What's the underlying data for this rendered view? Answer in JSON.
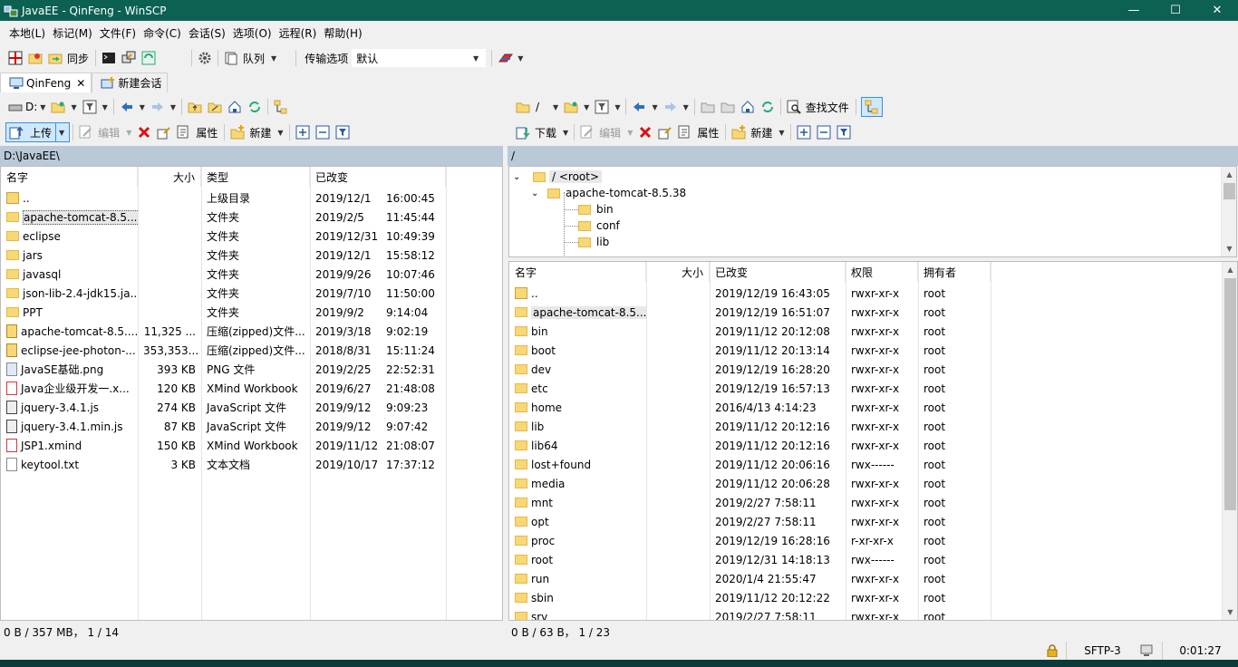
{
  "window": {
    "title": "JavaEE - QinFeng - WinSCP",
    "min": "—",
    "max": "☐",
    "close": "✕"
  },
  "menu": [
    "本地(L)",
    "标记(M)",
    "文件(F)",
    "命令(C)",
    "会话(S)",
    "选项(O)",
    "远程(R)",
    "帮助(H)"
  ],
  "toolbar": {
    "sync": "同步",
    "queue": "队列",
    "transfer_label": "传输选项",
    "transfer_value": "默认"
  },
  "tabs": [
    {
      "label": "QinFeng",
      "close": "✕"
    },
    {
      "label": "新建会话"
    }
  ],
  "left": {
    "drive": "D:",
    "upload": "上传",
    "edit": "编辑",
    "props": "属性",
    "new": "新建",
    "path": "D:\\JavaEE\\",
    "columns": [
      "名字",
      "大小",
      "类型",
      "已改变"
    ],
    "rows": [
      {
        "name": "..",
        "size": "",
        "type": "上级目录",
        "date": "2019/12/1",
        "time": "16:00:45",
        "icon": "up"
      },
      {
        "name": "apache-tomcat-8.5....",
        "size": "",
        "type": "文件夹",
        "date": "2019/2/5",
        "time": "11:45:44",
        "icon": "folder"
      },
      {
        "name": "eclipse",
        "size": "",
        "type": "文件夹",
        "date": "2019/12/31",
        "time": "10:49:39",
        "icon": "folder"
      },
      {
        "name": "jars",
        "size": "",
        "type": "文件夹",
        "date": "2019/12/1",
        "time": "15:58:12",
        "icon": "folder"
      },
      {
        "name": "javasql",
        "size": "",
        "type": "文件夹",
        "date": "2019/9/26",
        "time": "10:07:46",
        "icon": "folder"
      },
      {
        "name": "json-lib-2.4-jdk15.ja...",
        "size": "",
        "type": "文件夹",
        "date": "2019/7/10",
        "time": "11:50:00",
        "icon": "folder"
      },
      {
        "name": "PPT",
        "size": "",
        "type": "文件夹",
        "date": "2019/9/2",
        "time": "9:14:04",
        "icon": "folder"
      },
      {
        "name": "apache-tomcat-8.5....",
        "size": "11,325 ...",
        "type": "压缩(zipped)文件...",
        "date": "2019/3/18",
        "time": "9:02:19",
        "icon": "zip"
      },
      {
        "name": "eclipse-jee-photon-...",
        "size": "353,353...",
        "type": "压缩(zipped)文件...",
        "date": "2018/8/31",
        "time": "15:11:24",
        "icon": "zip"
      },
      {
        "name": "JavaSE基础.png",
        "size": "393 KB",
        "type": "PNG 文件",
        "date": "2019/2/25",
        "time": "22:52:31",
        "icon": "img"
      },
      {
        "name": "Java企业级开发一.x...",
        "size": "120 KB",
        "type": "XMind Workbook",
        "date": "2019/6/27",
        "time": "21:48:08",
        "icon": "xmind"
      },
      {
        "name": "jquery-3.4.1.js",
        "size": "274 KB",
        "type": "JavaScript 文件",
        "date": "2019/9/12",
        "time": "9:09:23",
        "icon": "js"
      },
      {
        "name": "jquery-3.4.1.min.js",
        "size": "87 KB",
        "type": "JavaScript 文件",
        "date": "2019/9/12",
        "time": "9:07:42",
        "icon": "js"
      },
      {
        "name": "JSP1.xmind",
        "size": "150 KB",
        "type": "XMind Workbook",
        "date": "2019/11/12",
        "time": "21:08:07",
        "icon": "xmind"
      },
      {
        "name": "keytool.txt",
        "size": "3 KB",
        "type": "文本文档",
        "date": "2019/10/17",
        "time": "17:37:12",
        "icon": "txt"
      }
    ],
    "status": "0 B / 357 MB，  1 / 14"
  },
  "right": {
    "dir": "/",
    "download": "下载",
    "edit": "编辑",
    "props": "属性",
    "new": "新建",
    "find": "查找文件",
    "path": "/",
    "tree": [
      "/ <root>",
      "apache-tomcat-8.5.38",
      "bin",
      "conf",
      "lib"
    ],
    "columns": [
      "名字",
      "大小",
      "已改变",
      "权限",
      "拥有者"
    ],
    "rows": [
      {
        "name": "..",
        "date": "2019/12/19 16:43:05",
        "perm": "rwxr-xr-x",
        "owner": "root",
        "icon": "up"
      },
      {
        "name": "apache-tomcat-8.5....",
        "date": "2019/12/19 16:51:07",
        "perm": "rwxr-xr-x",
        "owner": "root",
        "icon": "folder"
      },
      {
        "name": "bin",
        "date": "2019/11/12 20:12:08",
        "perm": "rwxr-xr-x",
        "owner": "root",
        "icon": "folder"
      },
      {
        "name": "boot",
        "date": "2019/11/12 20:13:14",
        "perm": "rwxr-xr-x",
        "owner": "root",
        "icon": "folder"
      },
      {
        "name": "dev",
        "date": "2019/12/19 16:28:20",
        "perm": "rwxr-xr-x",
        "owner": "root",
        "icon": "folder"
      },
      {
        "name": "etc",
        "date": "2019/12/19 16:57:13",
        "perm": "rwxr-xr-x",
        "owner": "root",
        "icon": "folder"
      },
      {
        "name": "home",
        "date": "2016/4/13 4:14:23",
        "perm": "rwxr-xr-x",
        "owner": "root",
        "icon": "folder"
      },
      {
        "name": "lib",
        "date": "2019/11/12 20:12:16",
        "perm": "rwxr-xr-x",
        "owner": "root",
        "icon": "folder"
      },
      {
        "name": "lib64",
        "date": "2019/11/12 20:12:16",
        "perm": "rwxr-xr-x",
        "owner": "root",
        "icon": "folder"
      },
      {
        "name": "lost+found",
        "date": "2019/11/12 20:06:16",
        "perm": "rwx------",
        "owner": "root",
        "icon": "folder"
      },
      {
        "name": "media",
        "date": "2019/11/12 20:06:28",
        "perm": "rwxr-xr-x",
        "owner": "root",
        "icon": "folder"
      },
      {
        "name": "mnt",
        "date": "2019/2/27 7:58:11",
        "perm": "rwxr-xr-x",
        "owner": "root",
        "icon": "folder"
      },
      {
        "name": "opt",
        "date": "2019/2/27 7:58:11",
        "perm": "rwxr-xr-x",
        "owner": "root",
        "icon": "folder"
      },
      {
        "name": "proc",
        "date": "2019/12/19 16:28:16",
        "perm": "r-xr-xr-x",
        "owner": "root",
        "icon": "folder"
      },
      {
        "name": "root",
        "date": "2019/12/31 14:18:13",
        "perm": "rwx------",
        "owner": "root",
        "icon": "folder"
      },
      {
        "name": "run",
        "date": "2020/1/4 21:55:47",
        "perm": "rwxr-xr-x",
        "owner": "root",
        "icon": "folder"
      },
      {
        "name": "sbin",
        "date": "2019/11/12 20:12:22",
        "perm": "rwxr-xr-x",
        "owner": "root",
        "icon": "folder"
      },
      {
        "name": "srv",
        "date": "2019/2/27 7:58:11",
        "perm": "rwxr-xr-x",
        "owner": "root",
        "icon": "folder"
      }
    ],
    "status": "0 B / 63 B，  1 / 23"
  },
  "bottom": {
    "protocol": "SFTP-3",
    "elapsed": "0:01:27"
  },
  "colors": {
    "titlebar": "#0c6153",
    "pathbar": "#b9c9d8",
    "folder": "#f8d775"
  }
}
